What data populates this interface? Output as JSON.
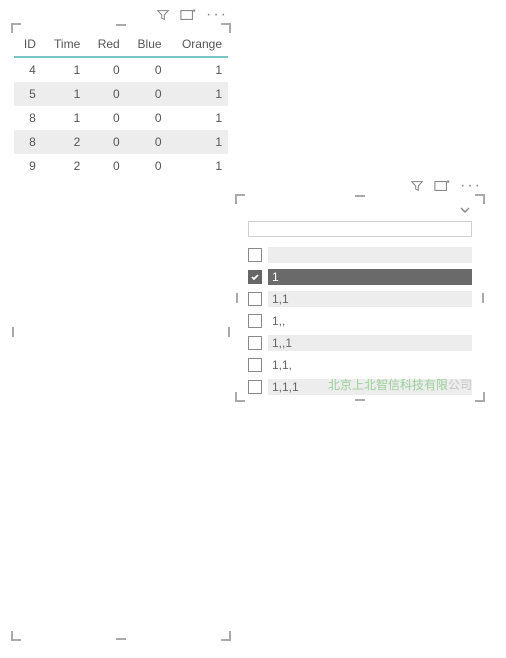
{
  "table": {
    "columns": [
      "ID",
      "Time",
      "Red",
      "Blue",
      "Orange"
    ],
    "rows": [
      [
        "4",
        "1",
        "0",
        "0",
        "1"
      ],
      [
        "5",
        "1",
        "0",
        "0",
        "1"
      ],
      [
        "8",
        "1",
        "0",
        "0",
        "1"
      ],
      [
        "8",
        "2",
        "0",
        "0",
        "1"
      ],
      [
        "9",
        "2",
        "0",
        "0",
        "1"
      ]
    ]
  },
  "slicer": {
    "search_placeholder": "",
    "items": [
      {
        "label": "",
        "checked": false,
        "highlighted": true
      },
      {
        "label": "1",
        "checked": true,
        "highlighted": false
      },
      {
        "label": "1,1",
        "checked": false,
        "highlighted": true
      },
      {
        "label": "1,,",
        "checked": false,
        "highlighted": false
      },
      {
        "label": "1,,1",
        "checked": false,
        "highlighted": true
      },
      {
        "label": "1,1,",
        "checked": false,
        "highlighted": false
      },
      {
        "label": "1,1,1",
        "checked": false,
        "highlighted": true
      }
    ]
  },
  "watermark": {
    "green": "北京上北智信科技有限",
    "gray": "公司"
  },
  "icons": {
    "filter": "filter-icon",
    "focus": "focus-mode-icon",
    "more": "more-options-icon",
    "chevron": "chevron-down-icon"
  }
}
